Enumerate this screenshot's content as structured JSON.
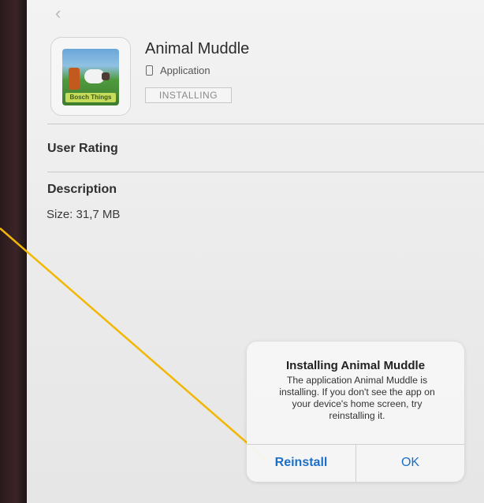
{
  "app": {
    "name": "Animal Muddle",
    "type": "Application",
    "status": "INSTALLING",
    "icon_logo": "Bosch Things"
  },
  "sections": {
    "user_rating": "User Rating",
    "description": "Description",
    "size": "Size: 31,7 MB"
  },
  "alert": {
    "title": "Installing Animal Muddle",
    "message": "The application Animal Muddle is installing. If you don't see the app on your device's home screen, try reinstalling it.",
    "reinstall_label": "Reinstall",
    "ok_label": "OK"
  },
  "icons": {
    "back": "chevron-left-icon",
    "device": "device-icon"
  },
  "colors": {
    "accent": "#1c6fc7",
    "annotation_line": "#f2b705"
  }
}
